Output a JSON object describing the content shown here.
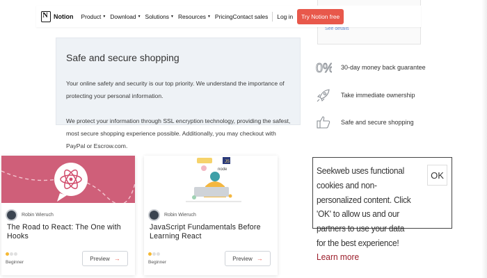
{
  "nav": {
    "brand": "Notion",
    "menu": [
      {
        "label": "Product",
        "has_dropdown": true
      },
      {
        "label": "Download",
        "has_dropdown": true
      },
      {
        "label": "Solutions",
        "has_dropdown": true
      },
      {
        "label": "Resources",
        "has_dropdown": true
      },
      {
        "label": "Pricing",
        "has_dropdown": false
      }
    ],
    "contact_sales": "Contact sales",
    "login": "Log in",
    "cta": "Try Notion free",
    "cta_color": "#e8584b"
  },
  "top_panel": {
    "partial_text": "See details"
  },
  "secure": {
    "heading": "Safe and secure shopping",
    "paragraph1": "Your online safety and security is our top priority. We understand the importance of protecting your personal information.",
    "paragraph2": "We protect your information through SSL encryption technology, providing the safest, most secure shopping experience possible. Additionally, you may checkout with PayPal or Escrow.com."
  },
  "features": [
    {
      "icon": "zero-percent-icon",
      "text": "30-day money back guarantee"
    },
    {
      "icon": "rocket-icon",
      "text": "Take immediate ownership"
    },
    {
      "icon": "thumbs-up-icon",
      "text": "Safe and secure shopping"
    }
  ],
  "courses": [
    {
      "author": "Robin Wieruch",
      "title": "The Road to React: The One with Hooks",
      "level": "Beginner",
      "level_rating": 1,
      "preview": "Preview",
      "thumb": "react-logo-speech-bubble"
    },
    {
      "author": "Robin Wieruch",
      "title": "JavaScript Fundamentals Before Learning React",
      "level": "Beginner",
      "level_rating": 1,
      "preview": "Preview",
      "thumb": "developer-illustration"
    }
  ],
  "cookie": {
    "text": "Seekweb uses functional cookies and non-personalized content. Click 'OK' to allow us and our partners to use your data for the best experience!",
    "link": "Learn more",
    "ok": "OK",
    "link_color": "#9b1d2a"
  }
}
